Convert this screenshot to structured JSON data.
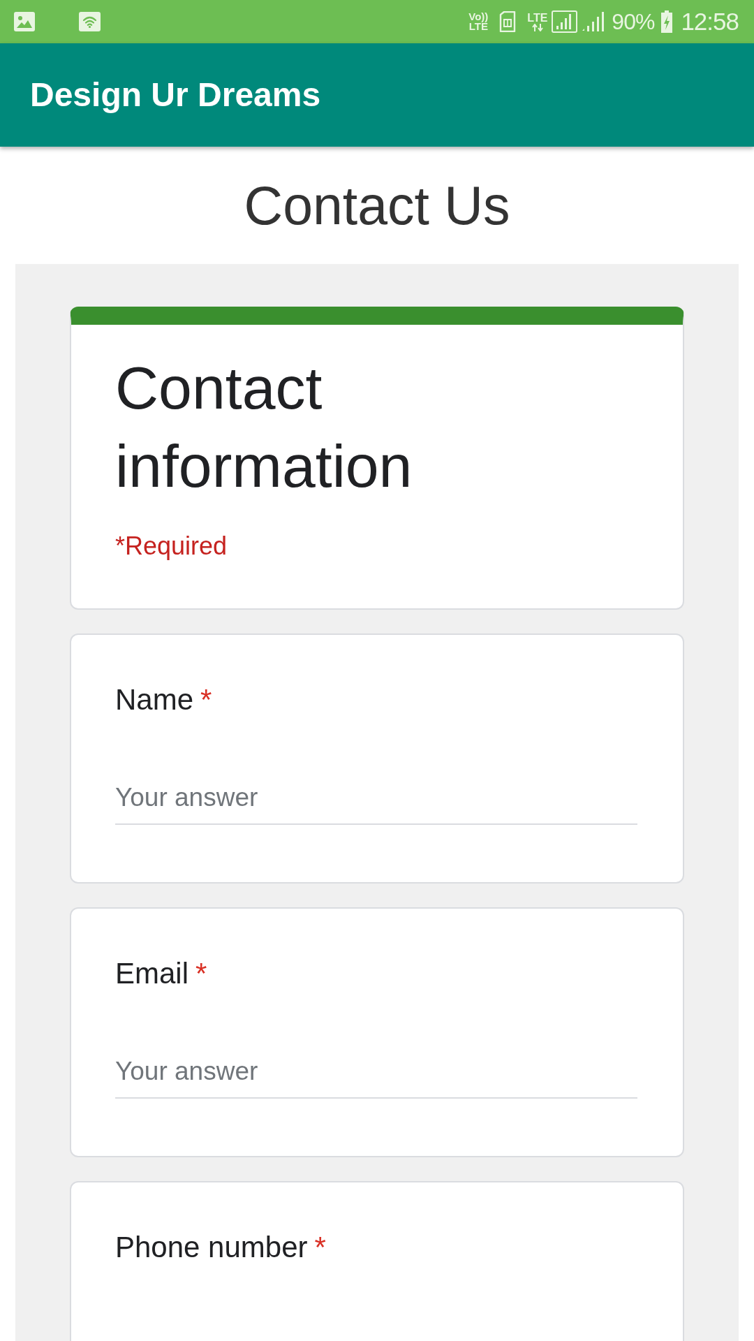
{
  "status_bar": {
    "volte": [
      "Vo))",
      "LTE"
    ],
    "network": "LTE",
    "battery": "90%",
    "time": "12:58"
  },
  "app_bar": {
    "title": "Design Ur Dreams"
  },
  "page_title": "Contact Us",
  "form": {
    "header": {
      "title": "Contact information",
      "required_note": "*Required"
    },
    "questions": [
      {
        "label": "Name",
        "required_mark": "*",
        "placeholder": "Your answer"
      },
      {
        "label": "Email",
        "required_mark": "*",
        "placeholder": "Your answer"
      },
      {
        "label": "Phone number",
        "required_mark": "*"
      }
    ]
  }
}
